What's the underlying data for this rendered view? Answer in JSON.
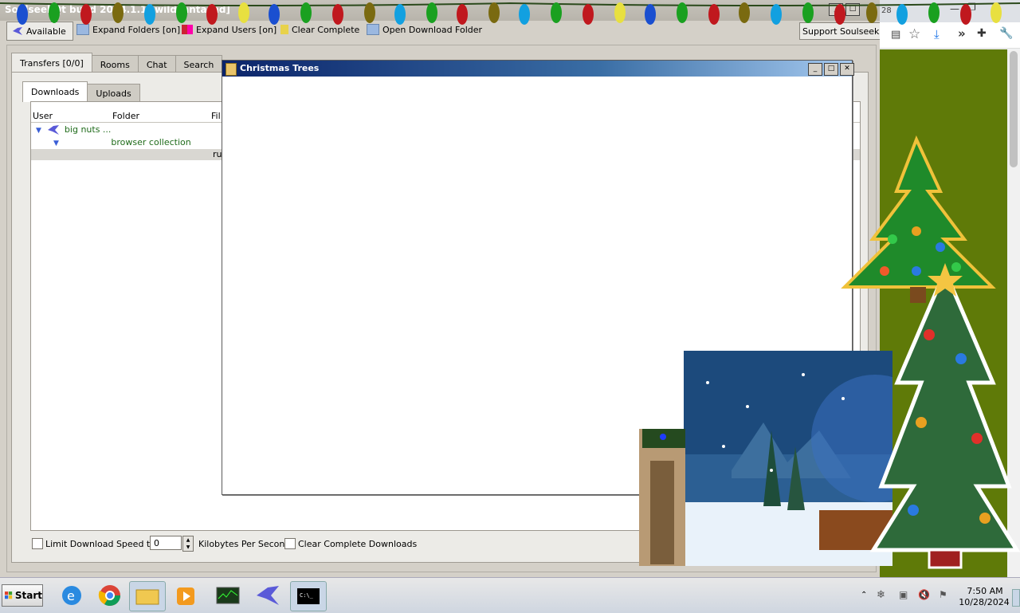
{
  "soulseek": {
    "title": "SoulseekQt build 2024.1.1 [wildsantasad]",
    "toolbar": {
      "available": "Available",
      "expand_folders": "Expand Folders [on]",
      "expand_users": "Expand Users [on]",
      "clear_complete": "Clear Complete",
      "open_download_folder": "Open Download Folder",
      "support": "Support Soulseek!"
    },
    "tabs": [
      "Transfers [0/0]",
      "Rooms",
      "Chat",
      "Search"
    ],
    "subtabs": [
      "Downloads",
      "Uploads"
    ],
    "columns": {
      "user": "User",
      "folder": "Folder",
      "file": "Fil"
    },
    "rows": {
      "user": "big nuts ...",
      "folder": "browser collection",
      "file": "ru"
    },
    "bottom": {
      "limit_label": "Limit Download Speed to",
      "limit_value": "0",
      "unit": "Kilobytes Per Second",
      "clear_label": "Clear Complete Downloads"
    }
  },
  "xmas_window": {
    "title": "Christmas Trees"
  },
  "browser": {
    "tab_fragment": "28"
  },
  "taskbar": {
    "start": "Start",
    "time": "7:50 AM",
    "date": "10/28/2024"
  },
  "colors": {
    "tree_text": "#1f6b1a",
    "olive_bg": "#5f7a08",
    "titlebar": "#0b246a"
  }
}
